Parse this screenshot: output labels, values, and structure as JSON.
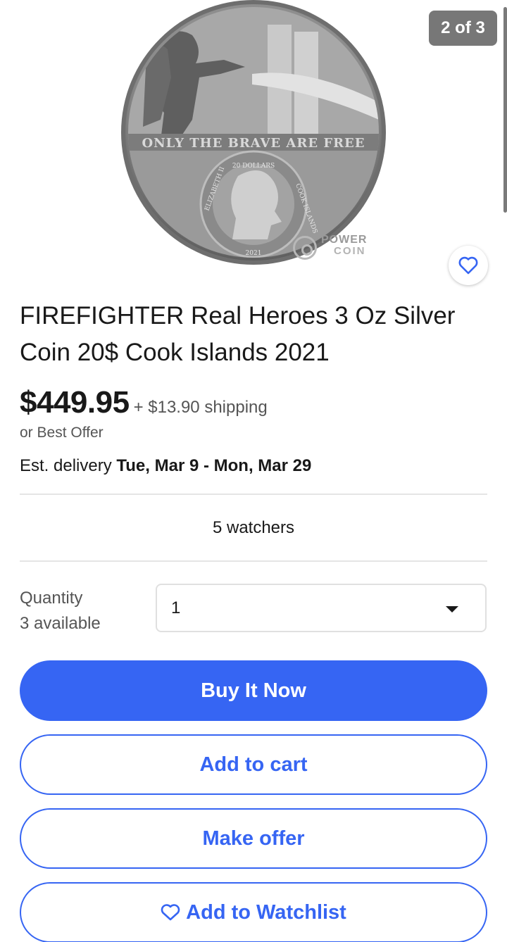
{
  "gallery": {
    "counter": "2 of 3",
    "coin_inscription": "ONLY THE BRAVE ARE FREE",
    "coin_denomination": "20 DOLLARS",
    "coin_left_text": "ELIZABETH II",
    "coin_right_text": "COOK ISLANDS",
    "coin_year": "2021",
    "watermark_line1": "POWER",
    "watermark_line2": "COIN"
  },
  "listing": {
    "title": "FIREFIGHTER Real Heroes 3 Oz Silver Coin 20$ Cook Islands 2021",
    "price": "$449.95",
    "shipping": "+ $13.90 shipping",
    "best_offer": "or Best Offer",
    "delivery_prefix": "Est. delivery",
    "delivery_dates": "Tue, Mar 9 - Mon, Mar 29",
    "watchers": "5 watchers"
  },
  "quantity": {
    "label": "Quantity",
    "available": "3 available",
    "selected": "1"
  },
  "actions": {
    "buy_now": "Buy It Now",
    "add_to_cart": "Add to cart",
    "make_offer": "Make offer",
    "add_to_watchlist": "Add to Watchlist"
  },
  "colors": {
    "accent": "#3665f3",
    "text": "#191919",
    "muted": "#555555",
    "divider": "#e5e5e5"
  }
}
